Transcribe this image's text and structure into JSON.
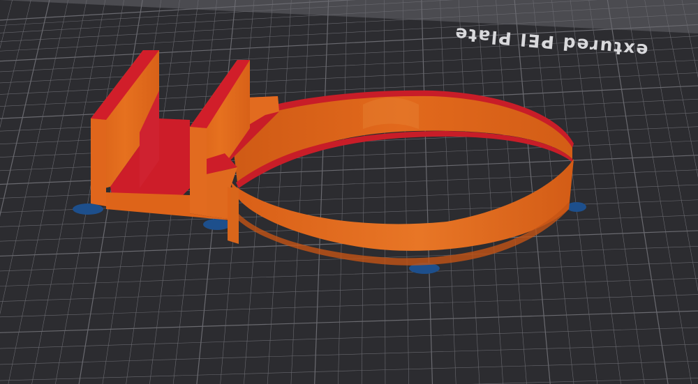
{
  "viewport": {
    "plate_label": "Textured PEI Plate",
    "plate_label_visible": "extured PEI Plate",
    "background_color": "#4d4d52",
    "bed_color": "#2c2c30",
    "grid_color": "#6a6a70"
  },
  "model": {
    "name": "",
    "filament_color": "#e0661c",
    "overhang_color": "#d31f2b",
    "support_brim_color": "#1d4f8c"
  }
}
